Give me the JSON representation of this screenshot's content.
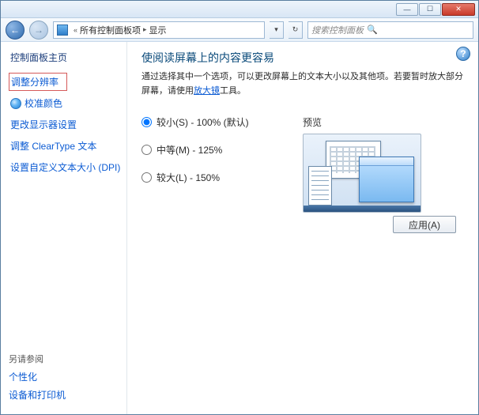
{
  "titlebar": {
    "min": "—",
    "max": "☐",
    "close": "✕"
  },
  "nav": {
    "back": "←",
    "fwd": "→"
  },
  "breadcrumb": {
    "root_icon": "cp",
    "sep": "«",
    "level1": "所有控制面板项",
    "level2": "显示"
  },
  "search": {
    "placeholder": "搜索控制面板"
  },
  "sidebar": {
    "home": "控制面板主页",
    "items": [
      {
        "label": "调整分辨率",
        "selected": true
      },
      {
        "label": "校准颜色",
        "icon": true
      },
      {
        "label": "更改显示器设置"
      },
      {
        "label": "调整 ClearType 文本"
      },
      {
        "label": "设置自定义文本大小 (DPI)"
      }
    ],
    "seealso": "另请参阅",
    "bottom": [
      {
        "label": "个性化"
      },
      {
        "label": "设备和打印机"
      }
    ]
  },
  "main": {
    "title": "使阅读屏幕上的内容更容易",
    "desc_a": "通过选择其中一个选项，可以更改屏幕上的文本大小以及其他项。若要暂时放大部分屏幕，请使用",
    "desc_link": "放大镜",
    "desc_b": "工具。",
    "options": [
      {
        "key": "small",
        "label": "较小(S) - 100% (默认)",
        "checked": true
      },
      {
        "key": "medium",
        "label": "中等(M) - 125%"
      },
      {
        "key": "large",
        "label": "较大(L) - 150%"
      }
    ],
    "preview_label": "预览",
    "apply": "应用(A)"
  }
}
